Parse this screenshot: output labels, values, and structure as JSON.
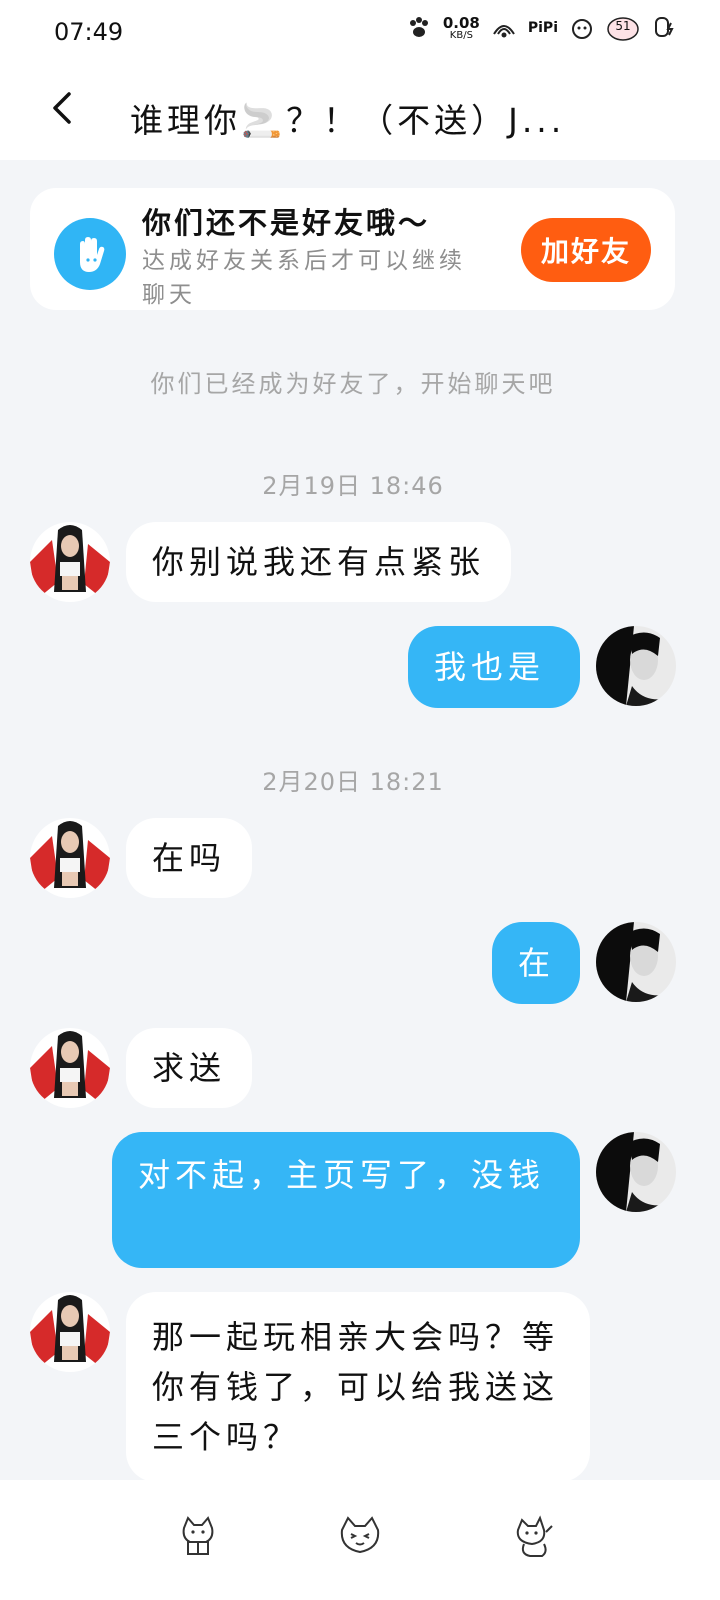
{
  "status_bar": {
    "time": "07:49",
    "net_speed_value": "0.08",
    "net_speed_unit": "KB/S",
    "app_label": "PiPi",
    "badge_count": "51"
  },
  "nav": {
    "title": "谁理你🚬？！（不送）J..."
  },
  "notice": {
    "title": "你们还不是好友哦～",
    "desc": "达成好友关系后才可以继续聊天",
    "button": "加好友"
  },
  "system_message": "你们已经成为好友了，开始聊天吧",
  "timestamps": [
    "2月19日 18:46",
    "2月20日 18:21"
  ],
  "messages": [
    {
      "side": "left",
      "text": "你别说我还有点紧张"
    },
    {
      "side": "right",
      "text": "我也是"
    },
    {
      "side": "left",
      "text": "在吗"
    },
    {
      "side": "right",
      "text": "在"
    },
    {
      "side": "left",
      "text": "求送"
    },
    {
      "side": "right",
      "text": "对不起，主页写了，没钱"
    },
    {
      "side": "left",
      "text": "那一起玩相亲大会吗？等你有钱了，可以给我送这三个吗？"
    }
  ],
  "colors": {
    "accent_blue": "#35b6f6",
    "add_friend_orange": "#ff5d11",
    "background": "#f3f5f8"
  },
  "bottom_icons": [
    "cat-gift-icon",
    "cat-face-icon",
    "cat-wave-icon"
  ]
}
